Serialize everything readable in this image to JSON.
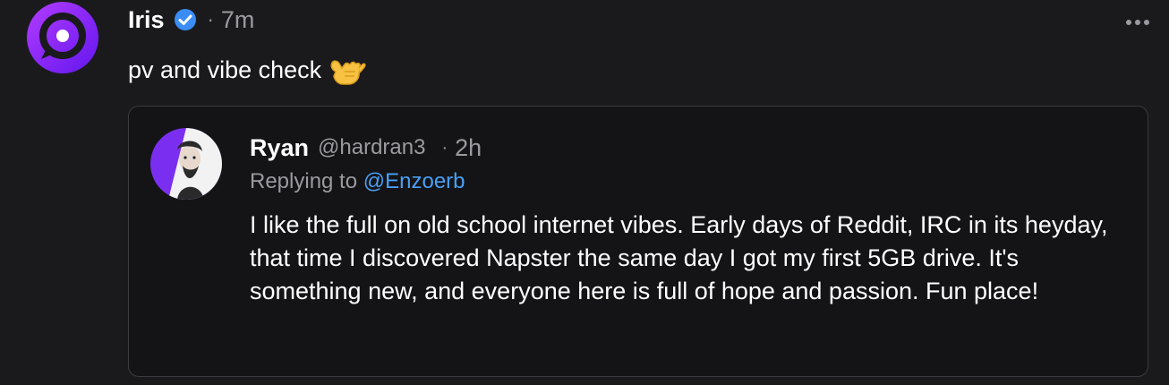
{
  "post": {
    "author_name": "Iris",
    "separator": "·",
    "time": "7m",
    "text": "pv and vibe check",
    "emoji": "call-me-hand-emoji",
    "avatar_colors": [
      "#a332f5",
      "#6a1cf0"
    ],
    "verified_color": "#3b8df5"
  },
  "quote": {
    "author_name": "Ryan",
    "handle": "@hardran3",
    "separator": "·",
    "time": "2h",
    "replying_prefix": "Replying to",
    "replying_mention": "@Enzoerb",
    "body": "I like the full on old school internet vibes. Early days of Reddit, IRC in its heyday, that time I discovered Napster the same day I got my first 5GB drive. It's something new, and everyone here is full of hope and passion. Fun place!",
    "avatar_color": "#7a2ff0",
    "mention_color": "#4a9ff5"
  },
  "icons": {
    "more": "more-dots-icon",
    "verified": "verified-check-icon"
  }
}
